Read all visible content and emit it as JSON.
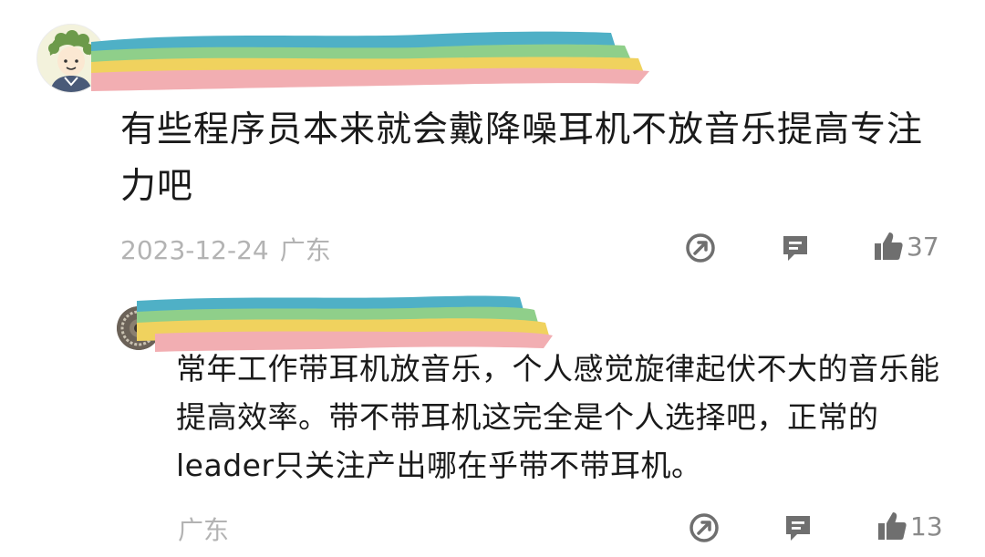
{
  "comment": {
    "text": "有些程序员本来就会戴降噪耳机不放音乐提高专注力吧",
    "date": "2023-12-24",
    "region": "广东",
    "like_count": "37",
    "icons": [
      "share-icon",
      "reply-icon",
      "thumbs-up-icon"
    ]
  },
  "reply": {
    "text": "常年工作带耳机放音乐，个人感觉旋律起伏不大的音乐能提高效率。带不带耳机这完全是个人选择吧，正常的leader只关注产出哪在乎带不带耳机。",
    "region": "广东",
    "like_count": "13",
    "icons": [
      "share-icon",
      "reply-icon",
      "thumbs-up-icon"
    ]
  },
  "colors": {
    "rainbow_band_1": "#4fb0c6",
    "rainbow_band_2": "#8fcf8a",
    "rainbow_band_3": "#f0d25e",
    "rainbow_band_4": "#f2aeb2",
    "meta_text": "#b3b3b3",
    "icon": "#6f6f6f"
  }
}
